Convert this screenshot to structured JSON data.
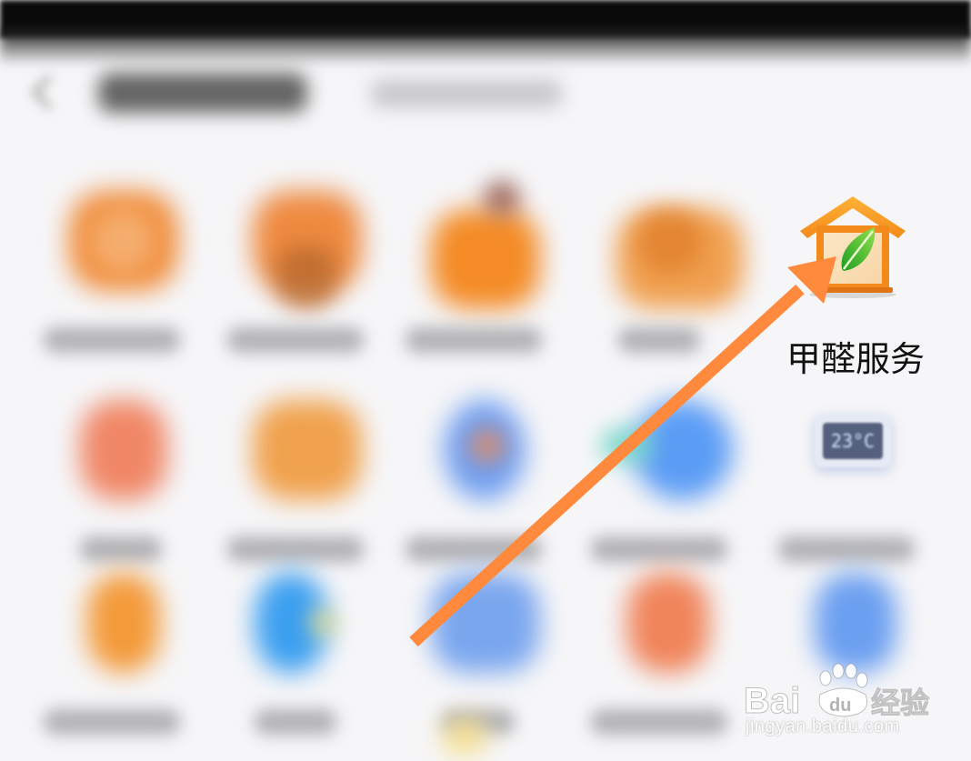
{
  "featured_item": {
    "label": "甲醛服务",
    "icon": "house-leaf-icon"
  },
  "thermostat_icon": {
    "display": "23°C"
  },
  "watermark": {
    "brand_text": "Bai du 经验",
    "url": "jingyan.baidu.com"
  },
  "colors": {
    "arrow": "#ff8a3d",
    "house_orange": "#f28a1c",
    "leaf_green": "#4cbf2a"
  }
}
